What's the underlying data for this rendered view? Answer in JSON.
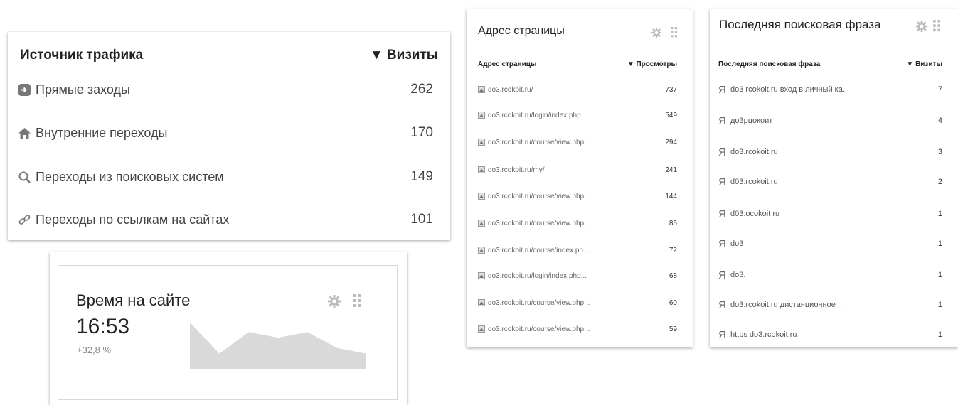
{
  "traffic": {
    "header_label": "Источник трафика",
    "header_metric": "▼ Визиты",
    "rows": [
      {
        "label": "Прямые заходы",
        "value": "262",
        "icon": "arrow-in-icon"
      },
      {
        "label": "Внутренние переходы",
        "value": "170",
        "icon": "home-icon"
      },
      {
        "label": "Переходы из поисковых систем",
        "value": "149",
        "icon": "search-icon"
      },
      {
        "label": "Переходы по ссылкам на сайтах",
        "value": "101",
        "icon": "link-icon"
      }
    ]
  },
  "time_on_site": {
    "title": "Время на сайте",
    "value": "16:53",
    "delta": "+32,8 %",
    "sparkline": [
      0.83,
      0.28,
      0.66,
      0.56,
      0.66,
      0.38,
      0.28
    ]
  },
  "pages": {
    "title": "Адрес страницы",
    "col_label": "Адрес страницы",
    "col_metric": "▼ Просмотры",
    "rows": [
      {
        "label": "do3.rcokoit.ru/",
        "value": "737"
      },
      {
        "label": "do3.rcokoit.ru/login/index.php",
        "value": "549"
      },
      {
        "label": "do3.rcokoit.ru/course/view.php...",
        "value": "294"
      },
      {
        "label": "do3.rcokoit.ru/my/",
        "value": "241"
      },
      {
        "label": "do3.rcokoit.ru/course/view.php...",
        "value": "144"
      },
      {
        "label": "do3.rcokoit.ru/course/view.php...",
        "value": "86"
      },
      {
        "label": "do3.rcokoit.ru/course/index.ph...",
        "value": "72"
      },
      {
        "label": "do3.rcokoit.ru/login/index.php...",
        "value": "68"
      },
      {
        "label": "do3.rcokoit.ru/course/view.php...",
        "value": "60"
      },
      {
        "label": "do3.rcokoit.ru/course/view.php...",
        "value": "59"
      }
    ]
  },
  "search": {
    "title": "Последняя поисковая фраза",
    "col_label": "Последняя поисковая фраза",
    "col_metric": "▼ Визиты",
    "engine_glyph": "Я",
    "rows": [
      {
        "label": "do3 rcokoit.ru вход в личный ка...",
        "value": "7"
      },
      {
        "label": "до3рцокоит",
        "value": "4"
      },
      {
        "label": "do3.rcokoit.ru",
        "value": "3"
      },
      {
        "label": "d03.rcokoit.ru",
        "value": "2"
      },
      {
        "label": "d03.ocokoit ru",
        "value": "1"
      },
      {
        "label": "do3",
        "value": "1"
      },
      {
        "label": "do3.",
        "value": "1"
      },
      {
        "label": "do3.rcokoit.ru дистанционное ...",
        "value": "1"
      },
      {
        "label": "https do3.rcokoit.ru",
        "value": "1"
      }
    ]
  }
}
